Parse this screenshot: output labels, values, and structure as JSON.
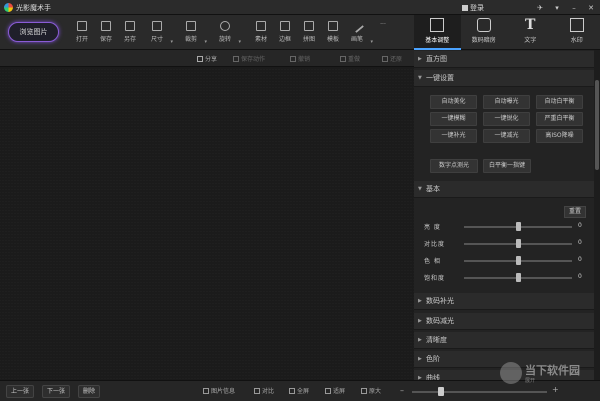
{
  "app": {
    "title": "光影魔术手"
  },
  "titlebar": {
    "login_label": "登录",
    "controls": [
      "✈",
      "▾",
      "–",
      "✕"
    ]
  },
  "toolbar": {
    "browse_label": "浏览图片",
    "tools": [
      {
        "label": "打开"
      },
      {
        "label": "保存"
      },
      {
        "label": "另存"
      },
      {
        "label": "尺寸"
      },
      {
        "label": "裁剪"
      },
      {
        "label": "旋转"
      },
      {
        "label": "素材"
      },
      {
        "label": "边框"
      },
      {
        "label": "拼图"
      },
      {
        "label": "模板"
      },
      {
        "label": "画笔"
      },
      {
        "label": "···"
      }
    ]
  },
  "panel_tabs": [
    {
      "label": "基本调整",
      "active": true
    },
    {
      "label": "数码暗房",
      "active": false
    },
    {
      "label": "文字",
      "icon_text": "T",
      "active": false
    },
    {
      "label": "水印",
      "active": false
    }
  ],
  "subbar": {
    "share": "分享",
    "save_action": "保存动作",
    "undo": "撤销",
    "redo": "重做",
    "restore": "还原"
  },
  "panel": {
    "histogram": "直方图",
    "one_click": "一键设置",
    "one_click_buttons": [
      "自动美化",
      "自动曝光",
      "自动白平衡",
      "一键模糊",
      "一键锐化",
      "严重白平衡",
      "一键补光",
      "一键减光",
      "高ISO降噪"
    ],
    "extra_buttons": [
      "数字点测光",
      "白平衡一指键"
    ],
    "basic": "基本",
    "reset": "重置",
    "sliders": [
      {
        "name": "亮 度",
        "value": "0",
        "level": 0.5
      },
      {
        "name": "对比度",
        "value": "0",
        "level": 0.5
      },
      {
        "name": "色 相",
        "value": "0",
        "level": 0.5
      },
      {
        "name": "饱和度",
        "value": "0",
        "level": 0.5
      }
    ],
    "collapsed_sections": [
      "数码补光",
      "数码减光",
      "清晰度",
      "色阶",
      "曲线"
    ]
  },
  "bottombar": {
    "prev": "上一张",
    "next": "下一张",
    "delete": "删除",
    "info": "图片信息",
    "compare": "对比",
    "fullscreen": "全屏",
    "fit": "适屏",
    "original": "原大",
    "zoom_minus": "–",
    "zoom_plus": "+"
  },
  "watermark": {
    "text": "当下软件园",
    "sub": "展开"
  }
}
